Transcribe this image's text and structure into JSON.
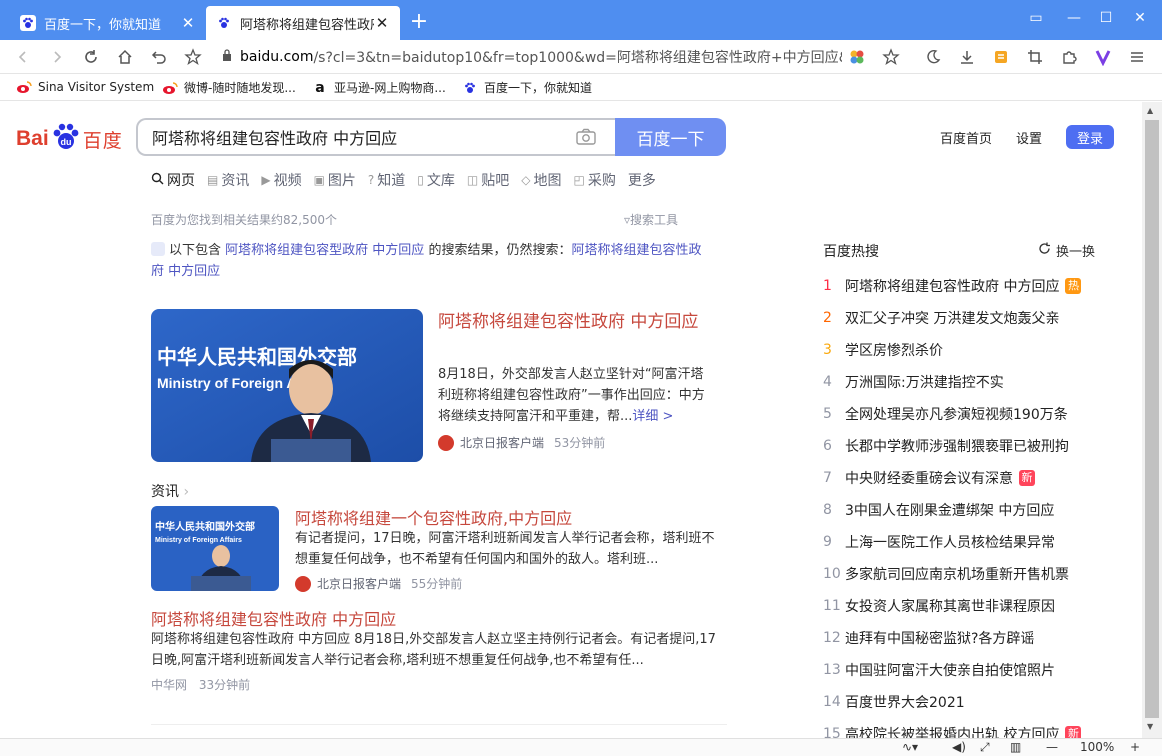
{
  "browser": {
    "tabs": [
      {
        "title": "百度一下，你就知道",
        "active": false
      },
      {
        "title": "阿塔称将组建包容性政府",
        "active": true
      }
    ],
    "url_host": "baidu.com",
    "url_rest": "/s?cl=3&tn=baidutop10&fr=top1000&wd=阿塔称将组建包容性政府+中方回应&",
    "bookmarks": [
      {
        "label": "Sina Visitor System",
        "icon": "sina-icon"
      },
      {
        "label": "微博-随时随地发现...",
        "icon": "weibo-icon"
      },
      {
        "label": "亚马逊-网上购物商...",
        "icon": "amazon-icon"
      },
      {
        "label": "百度一下，你就知道",
        "icon": "baidu-paw-icon"
      }
    ],
    "zoom": "100%"
  },
  "header": {
    "logo_left": "Bai",
    "logo_right": "百度",
    "query": "阿塔称将组建包容性政府 中方回应",
    "search_button": "百度一下",
    "links": [
      "百度首页",
      "设置"
    ],
    "login": "登录"
  },
  "search_tabs": [
    {
      "icon": "search-icon",
      "label": "网页",
      "active": true
    },
    {
      "icon": "news-icon",
      "label": "资讯"
    },
    {
      "icon": "video-icon",
      "label": "视频"
    },
    {
      "icon": "image-icon",
      "label": "图片"
    },
    {
      "icon": "zhidao-icon",
      "label": "知道"
    },
    {
      "icon": "wenku-icon",
      "label": "文库"
    },
    {
      "icon": "tieba-icon",
      "label": "贴吧"
    },
    {
      "icon": "map-icon",
      "label": "地图"
    },
    {
      "icon": "caigou-icon",
      "label": "采购"
    },
    {
      "icon": "",
      "label": "更多"
    }
  ],
  "result_count": "百度为您找到相关结果约82,500个",
  "tools": "搜索工具",
  "hint": {
    "prefix": "以下包含",
    "link1": "阿塔称将组建包容型政府 中方回应",
    "middle": "的搜索结果，仍然搜索：",
    "link2": "阿塔称将组建包容性政府 中方回应"
  },
  "card1": {
    "banner_cn": "中华人民共和国外交部",
    "banner_en": "Ministry of Foreign Affairs",
    "title": "阿塔称将组建包容性政府 中方回应",
    "desc": "8月18日，外交部发言人赵立坚针对“阿富汗塔利班称将组建包容性政府”一事作出回应：中方将继续支持阿富汗和平重建，帮...",
    "more": "详细 >",
    "source": "北京日报客户端",
    "time": "53分钟前"
  },
  "news_label": "资讯",
  "card2": {
    "banner_cn": "中华人民共和国外交部",
    "banner_en": "Ministry of Foreign Affairs",
    "title": "阿塔称将组建一个包容性政府,中方回应",
    "desc": "有记者提问，17日晚，阿富汗塔利班新闻发言人举行记者会称，塔利班不想重复任何战争，也不希望有任何国内和国外的敌人。塔利班...",
    "source": "北京日报客户端",
    "time": "55分钟前"
  },
  "result3": {
    "title": "阿塔称将组建包容性政府 中方回应",
    "desc": "阿塔称将组建包容性政府 中方回应 8月18日,外交部发言人赵立坚主持例行记者会。有记者提问,17日晚,阿富汗塔利班新闻发言人举行记者会称,塔利班不想重复任何战争,也不希望有任...",
    "source": "中华网",
    "time": "33分钟前"
  },
  "hot": {
    "title": "百度热搜",
    "refresh": "换一换",
    "items": [
      {
        "n": "1",
        "text": "阿塔称将组建包容性政府 中方回应",
        "badge": "热"
      },
      {
        "n": "2",
        "text": "双汇父子冲突 万洪建发文炮轰父亲",
        "badge": ""
      },
      {
        "n": "3",
        "text": "学区房惨烈杀价",
        "badge": ""
      },
      {
        "n": "4",
        "text": "万洲国际:万洪建指控不实",
        "badge": ""
      },
      {
        "n": "5",
        "text": "全网处理吴亦凡参演短视频190万条",
        "badge": ""
      },
      {
        "n": "6",
        "text": "长郡中学教师涉强制猥亵罪已被刑拘",
        "badge": ""
      },
      {
        "n": "7",
        "text": "中央财经委重磅会议有深意",
        "badge": "新"
      },
      {
        "n": "8",
        "text": "3中国人在刚果金遭绑架 中方回应",
        "badge": ""
      },
      {
        "n": "9",
        "text": "上海一医院工作人员核检结果异常",
        "badge": ""
      },
      {
        "n": "10",
        "text": "多家航司回应南京机场重新开售机票",
        "badge": ""
      },
      {
        "n": "11",
        "text": "女投资人家属称其离世非课程原因",
        "badge": ""
      },
      {
        "n": "12",
        "text": "迪拜有中国秘密监狱?各方辟谣",
        "badge": ""
      },
      {
        "n": "13",
        "text": "中国驻阿富汗大使亲自拍使馆照片",
        "badge": ""
      },
      {
        "n": "14",
        "text": "百度世界大会2021",
        "badge": ""
      },
      {
        "n": "15",
        "text": "高校院长被举报婚内出轨 校方回应",
        "badge": "新"
      }
    ]
  }
}
